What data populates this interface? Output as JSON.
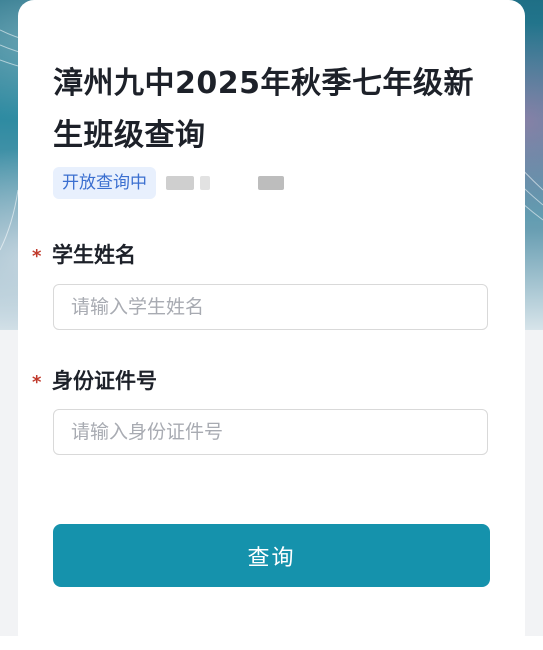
{
  "page": {
    "title": "漳州九中2025年秋季七年级新生班级查询",
    "status_tag": "开放查询中",
    "accent_color": "#1592ac"
  },
  "form": {
    "required_mark": "*",
    "fields": [
      {
        "label": "学生姓名",
        "value": "",
        "placeholder": "请输入学生姓名"
      },
      {
        "label": "身份证件号",
        "value": "",
        "placeholder": "请输入身份证件号"
      }
    ],
    "submit_label": "查询"
  }
}
